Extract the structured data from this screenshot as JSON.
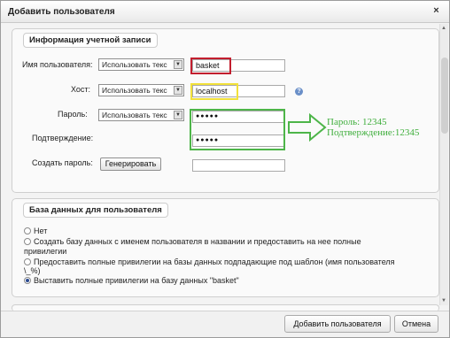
{
  "window": {
    "title": "Добавить пользователя",
    "close_glyph": "×"
  },
  "account": {
    "legend": "Информация учетной записи",
    "username": {
      "label": "Имя пользователя:",
      "mode": "Использовать текс",
      "value": "basket"
    },
    "host": {
      "label": "Хост:",
      "mode": "Использовать текс",
      "value": "localhost",
      "help_glyph": "?"
    },
    "password": {
      "label": "Пароль:",
      "mode": "Использовать текс",
      "value": "●●●●●"
    },
    "confirm": {
      "label": "Подтверждение:",
      "value": "●●●●●"
    },
    "generate": {
      "label": "Создать пароль:",
      "button": "Генерировать",
      "value": ""
    }
  },
  "annotation": {
    "line1": "Пароль: 12345",
    "line2": "Подтверждение:12345",
    "color": "#3fae3c"
  },
  "database": {
    "legend": "База данных для пользователя",
    "options": [
      {
        "text": "Нет",
        "checked": false
      },
      {
        "text": "Создать базу данных с именем пользователя в названии и предоставить на нее полные",
        "cont": "привилегии",
        "checked": false
      },
      {
        "text": "Предоставить полные привилегии на базы данных подпадающие под шаблон (имя пользователя",
        "cont": "\\_%)",
        "checked": false
      },
      {
        "text": "Выставить полные привилегии на базу данных \"basket\"",
        "checked": true
      }
    ]
  },
  "footer": {
    "add_button": "Добавить пользователя",
    "cancel_button": "Отмена"
  },
  "colors": {
    "highlight_red": "#c21e2e",
    "highlight_yellow": "#f2e13a",
    "highlight_green": "#4db549"
  }
}
